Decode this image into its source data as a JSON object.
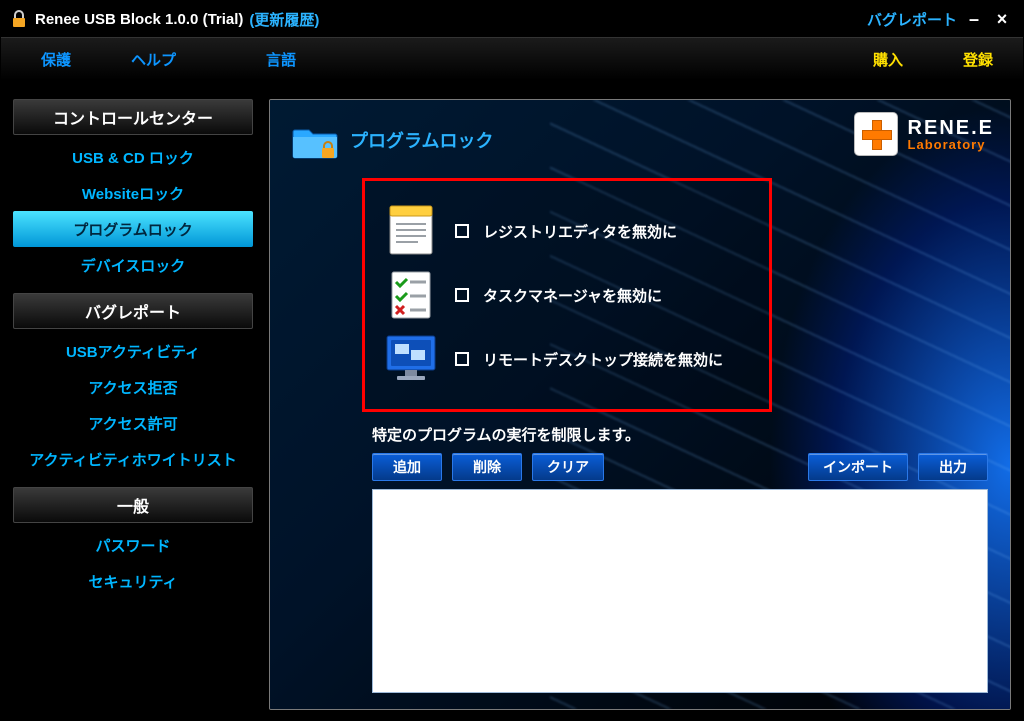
{
  "titlebar": {
    "title": "Renee USB Block 1.0.0 (Trial)",
    "changelog": "(更新履歴)",
    "bugreport": "バグレポート"
  },
  "menu": {
    "protect": "保護",
    "help": "ヘルプ",
    "language": "言語",
    "buy": "購入",
    "register": "登録"
  },
  "sidebar": {
    "sections": {
      "control_center": "コントロールセンター",
      "bug_report": "バグレポート",
      "general": "一般"
    },
    "control_center_items": [
      "USB & CD ロック",
      "Websiteロック",
      "プログラムロック",
      "デバイスロック"
    ],
    "bug_report_items": [
      "USBアクティビティ",
      "アクセス拒否",
      "アクセス許可",
      "アクティビティホワイトリスト"
    ],
    "general_items": [
      "パスワード",
      "セキュリティ"
    ],
    "active": "プログラムロック"
  },
  "main": {
    "heading": "プログラムロック",
    "options": [
      "レジストリエディタを無効に",
      "タスクマネージャを無効に",
      "リモートデスクトップ接続を無効に"
    ],
    "description": "特定のプログラムの実行を制限します。",
    "buttons": {
      "add": "追加",
      "delete": "削除",
      "clear": "クリア",
      "import": "インポート",
      "export": "出力"
    }
  },
  "logo": {
    "line1": "RENE.E",
    "line2": "Laboratory"
  }
}
